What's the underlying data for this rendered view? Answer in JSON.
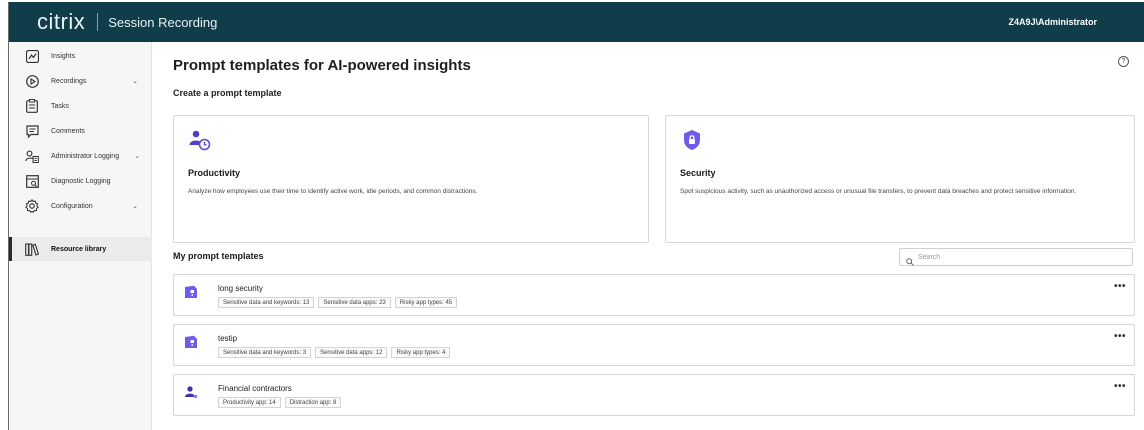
{
  "header": {
    "brand": "citrix",
    "product": "Session Recording",
    "user": "Z4A9J\\Administrator"
  },
  "sidebar": {
    "items": [
      {
        "label": "Insights",
        "icon": "insights-icon"
      },
      {
        "label": "Recordings",
        "icon": "play-icon",
        "expandable": true
      },
      {
        "label": "Tasks",
        "icon": "clipboard-icon"
      },
      {
        "label": "Comments",
        "icon": "comment-icon"
      },
      {
        "label": "Administrator Logging",
        "icon": "admin-logging-icon",
        "expandable": true
      },
      {
        "label": "Diagnostic Logging",
        "icon": "diagnostic-icon"
      },
      {
        "label": "Configuration",
        "icon": "gear-icon",
        "expandable": true
      },
      {
        "label": "Resource library",
        "icon": "library-icon",
        "active": true
      }
    ],
    "chevron": "⌄"
  },
  "main": {
    "title": "Prompt templates for AI-powered insights",
    "help": "?",
    "create_label": "Create a prompt template",
    "cards": [
      {
        "title": "Productivity",
        "description": "Analyze how employees use their time to identify active work, idle periods, and common distractions.",
        "icon": "person-clock-icon"
      },
      {
        "title": "Security",
        "description": "Spot suspicious activity, such as unauthorized access or unusual file transfers, to prevent data breaches and protect sensitive information.",
        "icon": "shield-lock-icon"
      }
    ],
    "my_templates_label": "My prompt templates",
    "search": {
      "placeholder": "Search",
      "value": ""
    },
    "templates": [
      {
        "name": "long security",
        "icon": "security-template-icon",
        "tags": [
          "Sensitive data and keywords: 13",
          "Sensitive data apps: 23",
          "Risky app types: 45"
        ]
      },
      {
        "name": "testip",
        "icon": "security-template-icon",
        "tags": [
          "Sensitive data and keywords: 3",
          "Sensitive data apps: 12",
          "Risky app types: 4"
        ]
      },
      {
        "name": "Financial contractors",
        "icon": "productivity-template-icon",
        "tags": [
          "Productivity app: 14",
          "Distraction app: 8"
        ]
      }
    ],
    "more_label": "•••"
  },
  "colors": {
    "topbar": "#0f3d4a",
    "accent": "#5b4bd6",
    "security_accent": "#6d5ce8"
  }
}
